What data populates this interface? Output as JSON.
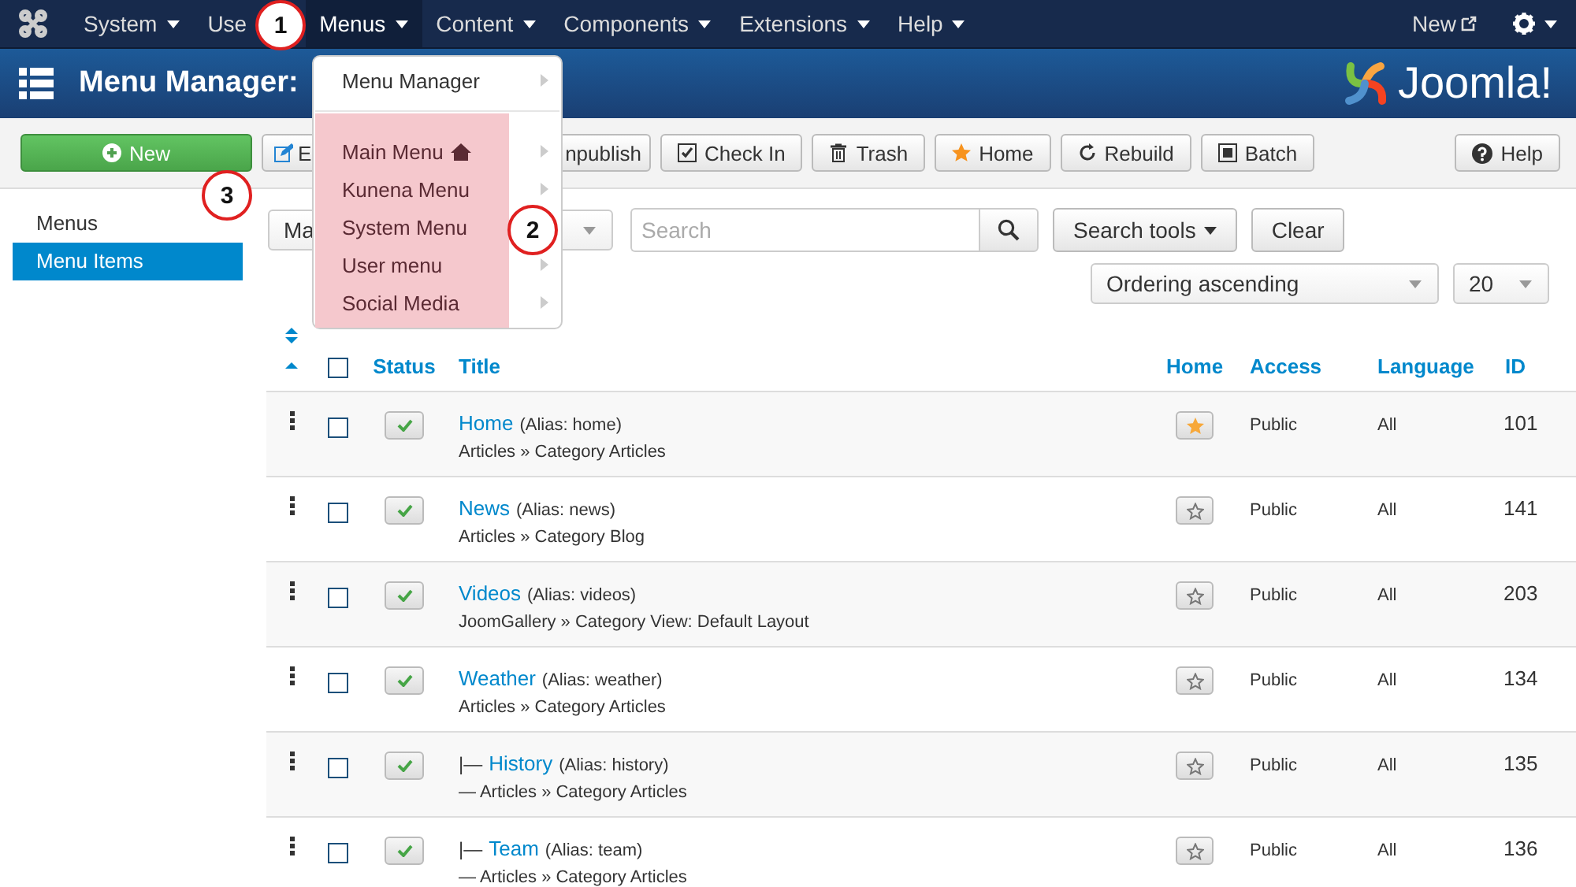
{
  "top_nav": {
    "items": [
      {
        "label": "System",
        "selected": false,
        "caret": true
      },
      {
        "label": "Use",
        "selected": false,
        "caret": false
      },
      {
        "label": "Menus",
        "selected": true,
        "caret": true
      },
      {
        "label": "Content",
        "selected": false,
        "caret": true
      },
      {
        "label": "Components",
        "selected": false,
        "caret": true
      },
      {
        "label": "Extensions",
        "selected": false,
        "caret": true
      },
      {
        "label": "Help",
        "selected": false,
        "caret": true
      }
    ],
    "new_link": "New"
  },
  "header": {
    "title": "Menu Manager:",
    "logo_text": "Joomla!"
  },
  "menus_dropdown": {
    "heading_item": "Menu Manager",
    "items": [
      {
        "label": "Main Menu",
        "home": true,
        "highlighted": true,
        "submenu_arrow": true
      },
      {
        "label": "Kunena Menu",
        "home": false,
        "highlighted": true,
        "submenu_arrow": true
      },
      {
        "label": "System Menu",
        "home": false,
        "highlighted": true,
        "submenu_arrow": false
      },
      {
        "label": "User menu",
        "home": false,
        "highlighted": true,
        "submenu_arrow": true
      },
      {
        "label": "Social Media",
        "home": false,
        "highlighted": true,
        "submenu_arrow": true
      }
    ]
  },
  "toolbar": {
    "buttons": [
      {
        "kind": "new",
        "label": "New"
      },
      {
        "kind": "edit",
        "label": "E"
      },
      {
        "kind": "unpublish",
        "label": "npublish"
      },
      {
        "kind": "checkin",
        "label": "Check In"
      },
      {
        "kind": "trash",
        "label": "Trash"
      },
      {
        "kind": "home",
        "label": "Home"
      },
      {
        "kind": "rebuild",
        "label": "Rebuild"
      },
      {
        "kind": "batch",
        "label": "Batch"
      }
    ],
    "help": "Help"
  },
  "sidebar": {
    "items": [
      {
        "label": "Menus",
        "selected": false
      },
      {
        "label": "Menu Items",
        "selected": true
      }
    ]
  },
  "filters": {
    "menu_select": "Ma",
    "search_placeholder": "Search",
    "search_tools": "Search tools",
    "clear": "Clear",
    "ordering": "Ordering ascending",
    "limit": "20"
  },
  "table": {
    "select_all_checked": false,
    "columns": [
      "Status",
      "Title",
      "Home",
      "Access",
      "Language",
      "ID"
    ],
    "rows": [
      {
        "checked": false,
        "title": "Home",
        "alias": "(Alias: home)",
        "path": "Articles » Category Articles",
        "published": true,
        "home": true,
        "access": "Public",
        "language": "All",
        "id": "101"
      },
      {
        "checked": false,
        "title": "News",
        "alias": "(Alias: news)",
        "path": "Articles » Category Blog",
        "published": true,
        "home": false,
        "access": "Public",
        "language": "All",
        "id": "141"
      },
      {
        "checked": false,
        "title": "Videos",
        "alias": "(Alias: videos)",
        "path": "JoomGallery » Category View: Default Layout",
        "published": true,
        "home": false,
        "access": "Public",
        "language": "All",
        "id": "203"
      },
      {
        "checked": false,
        "title": "Weather",
        "alias": "(Alias: weather)",
        "path": "Articles » Category Articles",
        "published": true,
        "home": false,
        "access": "Public",
        "language": "All",
        "id": "134"
      },
      {
        "checked": false,
        "level_mark": "|—",
        "title": "History",
        "alias": "(Alias: history)",
        "path": "— Articles » Category Articles",
        "published": true,
        "home": false,
        "access": "Public",
        "language": "All",
        "id": "135"
      },
      {
        "checked": false,
        "level_mark": "|—",
        "title": "Team",
        "alias": "(Alias: team)",
        "path": "— Articles » Category Articles",
        "published": true,
        "home": false,
        "access": "Public",
        "language": "All",
        "id": "136"
      }
    ]
  },
  "callouts": [
    {
      "number": "1"
    },
    {
      "number": "2"
    },
    {
      "number": "3"
    }
  ]
}
